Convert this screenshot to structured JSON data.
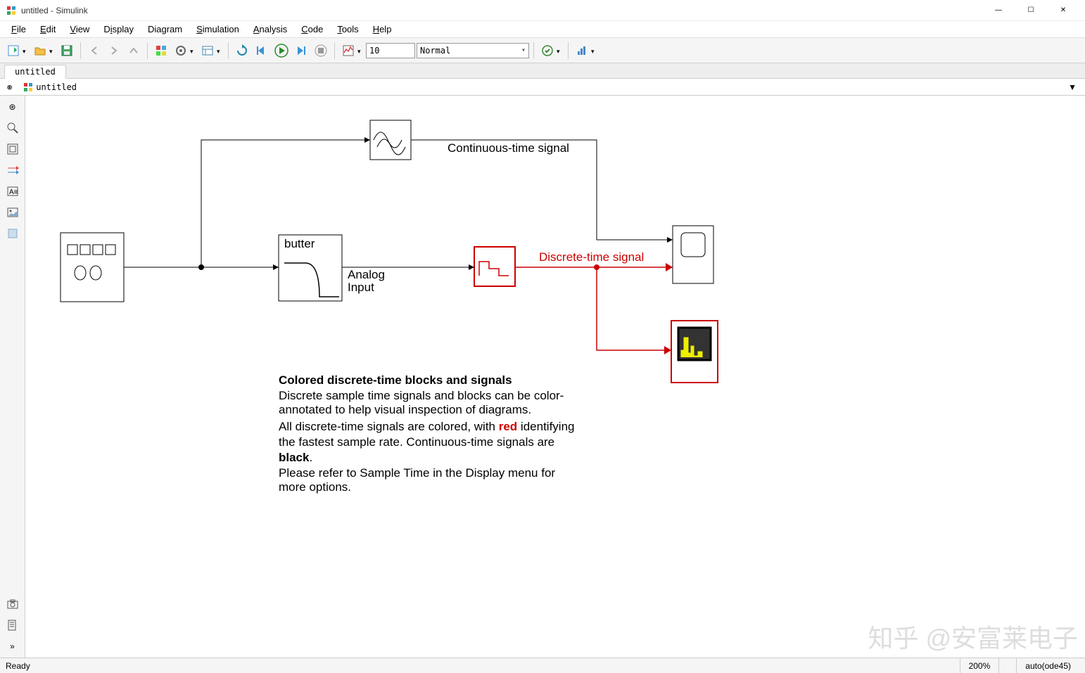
{
  "window": {
    "title": "untitled - Simulink"
  },
  "menu": {
    "file": "File",
    "edit": "Edit",
    "view": "View",
    "display": "Display",
    "diagram": "Diagram",
    "simulation": "Simulation",
    "analysis": "Analysis",
    "code": "Code",
    "tools": "Tools",
    "help": "Help"
  },
  "toolbar": {
    "stop_time": "10",
    "mode": "Normal"
  },
  "tab": {
    "name": "untitled"
  },
  "breadcrumb": {
    "model": "untitled"
  },
  "diagram": {
    "blocks": {
      "source": {
        "label": ""
      },
      "filter": {
        "label1": "butter",
        "label2a": "Analog",
        "label2b": "Input"
      },
      "scope_wave": "",
      "zoh": "",
      "scope": "",
      "spectrum": ""
    },
    "signals": {
      "cont": "Continuous-time signal",
      "disc": "Discrete-time signal"
    },
    "note": {
      "title": "Colored discrete-time blocks and signals",
      "l1": "Discrete sample time signals and blocks  can be color-",
      "l2": "annotated to help visual inspection of diagrams.",
      "l3a": "All discrete-time signals are colored, with ",
      "l3b": "red",
      "l3c": " identifying",
      "l4": "the fastest sample rate. Continuous-time signals are",
      "l5": "black",
      "l5b": ".",
      "l6": "Please refer to Sample Time in the Display menu for",
      "l7": "more options."
    }
  },
  "status": {
    "ready": "Ready",
    "zoom": "200%",
    "solver": "auto(ode45)"
  },
  "watermark": "知乎 @安富莱电子"
}
